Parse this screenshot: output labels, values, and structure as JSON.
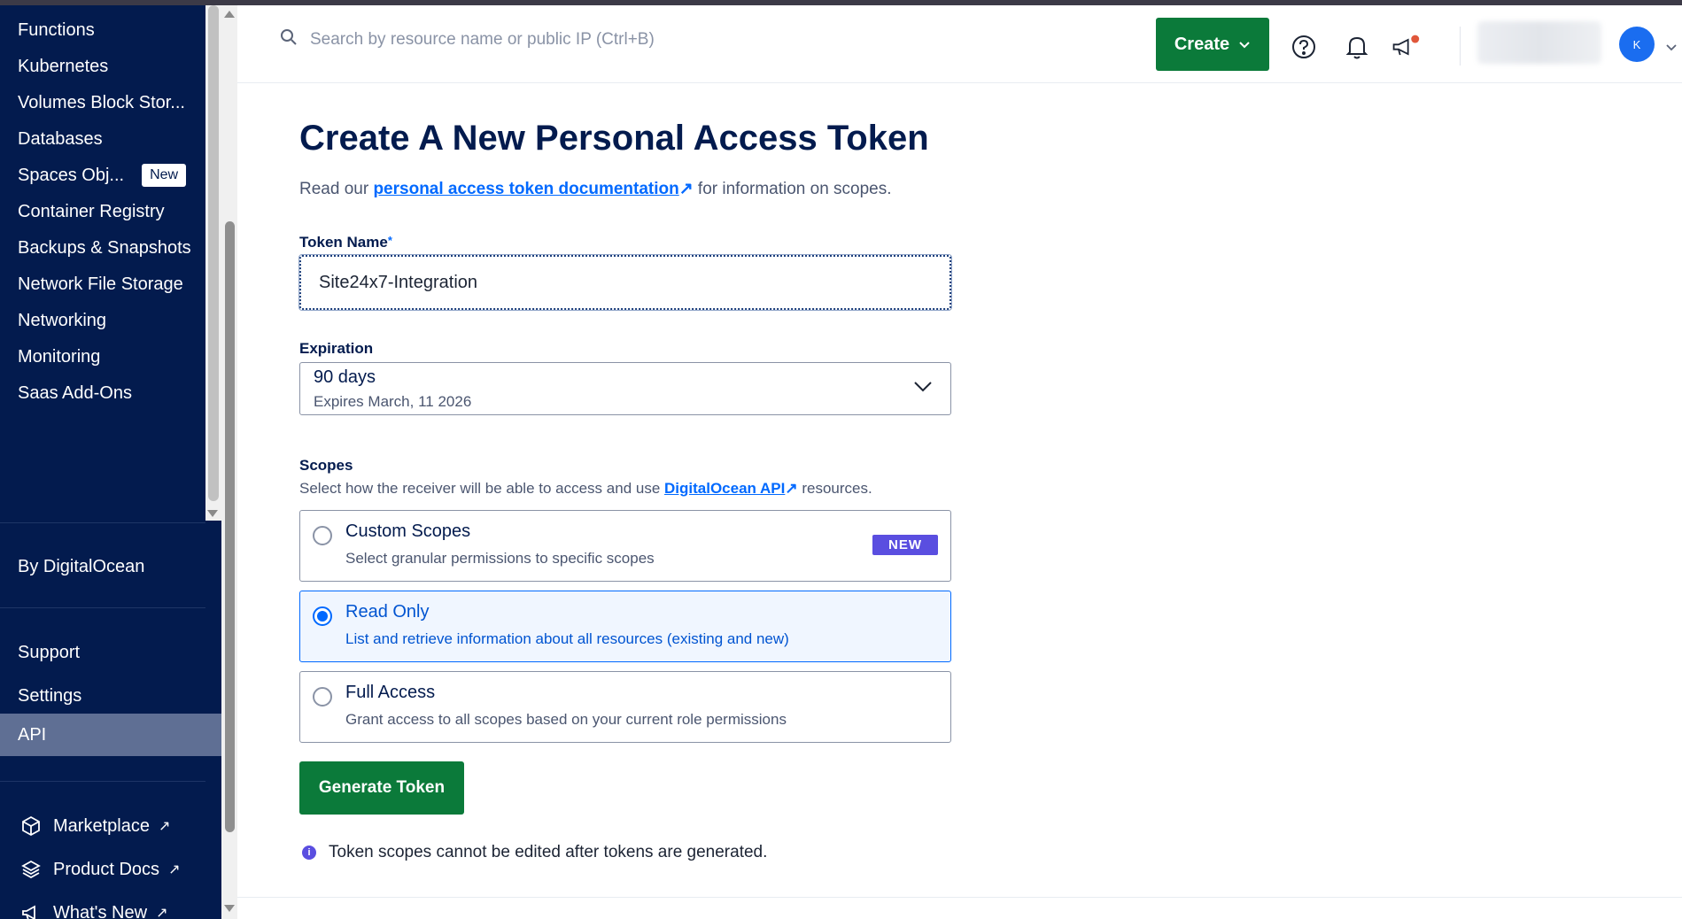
{
  "sidebar": {
    "items": [
      {
        "label": "Functions"
      },
      {
        "label": "Kubernetes"
      },
      {
        "label": "Volumes Block Stor..."
      },
      {
        "label": "Databases"
      },
      {
        "label": "Spaces Obj...",
        "badge": "New"
      },
      {
        "label": "Container Registry"
      },
      {
        "label": "Backups & Snapshots"
      },
      {
        "label": "Network File Storage"
      },
      {
        "label": "Networking"
      },
      {
        "label": "Monitoring"
      },
      {
        "label": "Saas Add-Ons"
      }
    ],
    "by_digitalocean": "By DigitalOcean",
    "account_items": [
      {
        "label": "Support"
      },
      {
        "label": "Settings"
      },
      {
        "label": "API",
        "active": true
      }
    ],
    "links": [
      {
        "label": "Marketplace",
        "icon": "cube-icon"
      },
      {
        "label": "Product Docs",
        "icon": "stack-icon"
      },
      {
        "label": "What's New",
        "icon": "megaphone-icon"
      }
    ]
  },
  "header": {
    "search_placeholder": "Search by resource name or public IP (Ctrl+B)",
    "create_label": "Create",
    "avatar_initial": "K"
  },
  "page": {
    "title": "Create A New Personal Access Token",
    "intro_prefix": "Read our ",
    "intro_link": "personal access token documentation",
    "intro_suffix": " for information on scopes.",
    "token_name_label": "Token Name",
    "token_name_required": "*",
    "token_name_value": "Site24x7-Integration",
    "expiration_label": "Expiration",
    "expiration_value": "90 days",
    "expiration_sub": "Expires March, 11 2026",
    "scopes_label": "Scopes",
    "scopes_desc_prefix": "Select how the receiver will be able to access and use ",
    "scopes_desc_link": "DigitalOcean API",
    "scopes_desc_suffix": " resources.",
    "options": [
      {
        "title": "Custom Scopes",
        "desc": "Select granular permissions to specific scopes",
        "badge": "NEW",
        "selected": false
      },
      {
        "title": "Read Only",
        "desc": "List and retrieve information about all resources (existing and new)",
        "selected": true
      },
      {
        "title": "Full Access",
        "desc": "Grant access to all scopes based on your current role permissions",
        "selected": false
      }
    ],
    "generate_label": "Generate Token",
    "note": "Token scopes cannot be edited after tokens are generated.",
    "note_icon_glyph": "i"
  },
  "colors": {
    "sidebar_bg": "#031b4e",
    "primary_green": "#0b7a3a",
    "link_blue": "#0069ff",
    "new_badge": "#5a4ee0",
    "notification_dot": "#e0573a"
  }
}
